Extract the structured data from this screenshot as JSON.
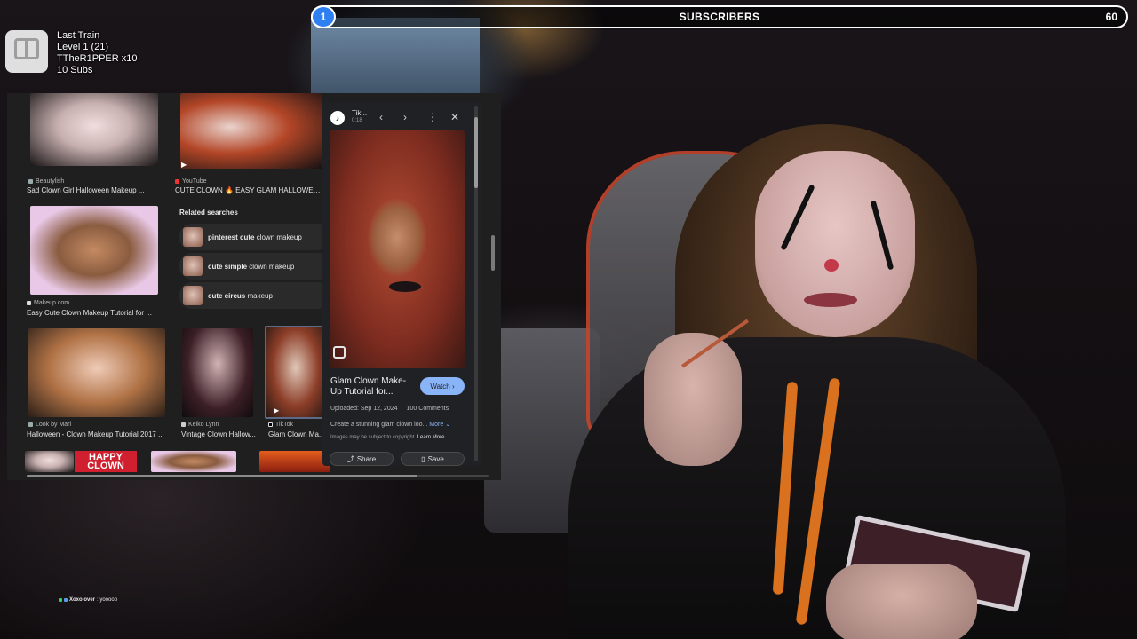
{
  "subscriber_goal": {
    "current": "1",
    "label": "SUBSCRIBERS",
    "target": "60",
    "accent_color": "#2e7ff1"
  },
  "train": {
    "icon": "train-icon",
    "title": "Last Train",
    "level": "Level 1  (21)",
    "user": "TTheR1PPER x10",
    "subs": "10 Subs"
  },
  "image_results": [
    {
      "source": "Beautylish",
      "caption": "Sad Clown Girl Halloween Makeup ..."
    },
    {
      "source": "YouTube",
      "caption": "CUTE CLOWN 🔥 EASY GLAM HALLOWEEN MA"
    },
    {
      "source": "Makeup.com",
      "caption": "Easy Cute Clown Makeup Tutorial for ..."
    },
    {
      "source": "Look by Mari",
      "caption": "Halloween - Clown Makeup Tutorial 2017 ..."
    },
    {
      "source": "Keiko Lynn",
      "caption": "Vintage Clown Hallow..."
    },
    {
      "source": "TikTok",
      "caption": "Glam Clown Ma..."
    }
  ],
  "bottom_thumb_text": "HAPPY\nCLOWN",
  "related": {
    "title": "Related searches",
    "items": [
      {
        "bold": "pinterest cute",
        "rest": " clown makeup"
      },
      {
        "bold": "cute simple",
        "rest": " clown makeup"
      },
      {
        "bold": "cute circus",
        "rest": " makeup"
      }
    ]
  },
  "preview": {
    "site_name": "Tik...",
    "site_sub": "0:18",
    "title": "Glam Clown Make-Up Tutorial for...",
    "watch_label": "Watch ›",
    "uploaded": "Uploaded: Sep 12, 2024",
    "comments": "100 Comments",
    "description": "Create a stunning glam clown loo...",
    "more": "More ⌄",
    "copyright": "Images may be subject to copyright.",
    "learn_more": "Learn More",
    "share_label": "Share",
    "save_label": "Save"
  },
  "chat": {
    "user": "Xoxolover",
    "message": ": yooooo"
  }
}
